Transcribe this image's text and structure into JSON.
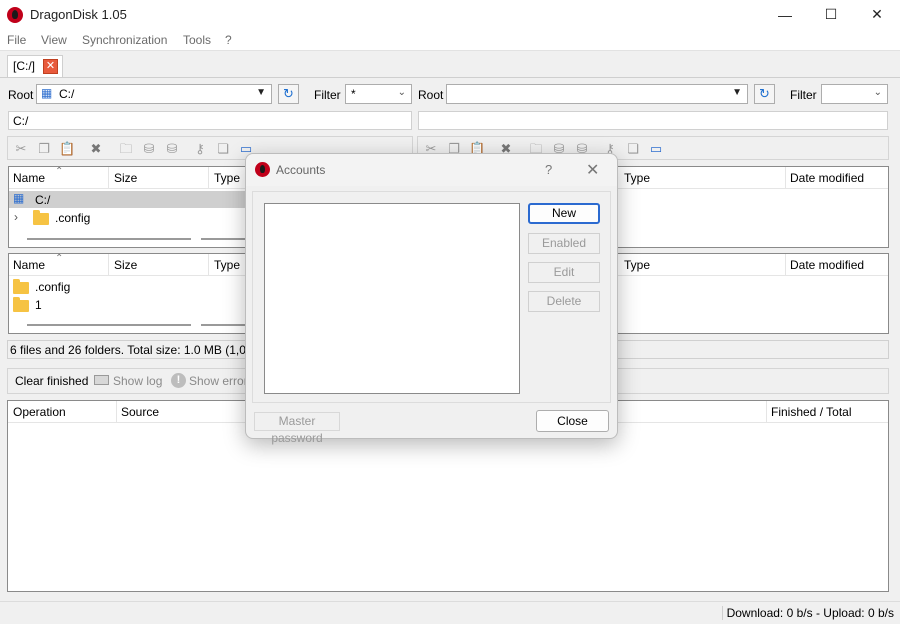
{
  "window": {
    "title": "DragonDisk 1.05",
    "controls": {
      "minimize": "—",
      "maximize": "☐",
      "close": "✕"
    }
  },
  "menu": [
    "File",
    "View",
    "Synchronization",
    "Tools",
    "?"
  ],
  "tab": {
    "label": "[C:/]",
    "close_glyph": "✕"
  },
  "left_pane": {
    "root_label": "Root",
    "root_value": "C:/",
    "filter_label": "Filter",
    "filter_value": "*",
    "path": "C:/",
    "tree": {
      "columns": [
        "Name",
        "Size",
        "Type"
      ],
      "rows": [
        {
          "name": "C:/",
          "kind": "drive"
        },
        {
          "name": ".config",
          "kind": "folder"
        }
      ]
    },
    "list": {
      "columns": [
        "Name",
        "Size",
        "Type"
      ],
      "rows": [
        {
          "name": ".config",
          "kind": "folder"
        },
        {
          "name": "1",
          "kind": "folder"
        }
      ]
    },
    "info": "6 files and 26 folders. Total size: 1.0 MB (1,085,9"
  },
  "right_pane": {
    "root_label": "Root",
    "root_value": "",
    "filter_label": "Filter",
    "filter_value": "",
    "path": "",
    "tree": {
      "columns": [
        "Type",
        "Date modified"
      ]
    },
    "list": {
      "columns": [
        "Type",
        "Date modified"
      ]
    }
  },
  "transfer_toolbar": {
    "clear_finished": "Clear finished",
    "show_log": "Show log",
    "show_error": "Show error"
  },
  "queue": {
    "columns": [
      "Operation",
      "Source",
      "Finished / Total"
    ]
  },
  "statusbar": {
    "text": "Download: 0 b/s - Upload: 0 b/s"
  },
  "dialog": {
    "title": "Accounts",
    "help": "?",
    "close_glyph": "✕",
    "buttons": {
      "new": "New",
      "enabled": "Enabled",
      "edit": "Edit",
      "delete": "Delete"
    },
    "master_password": "Master password",
    "close": "Close"
  },
  "colors": {
    "accent": "#2b6ad0",
    "app_icon": "#c0001a",
    "folder": "#f6c343",
    "tab_close": "#e85a3c"
  }
}
